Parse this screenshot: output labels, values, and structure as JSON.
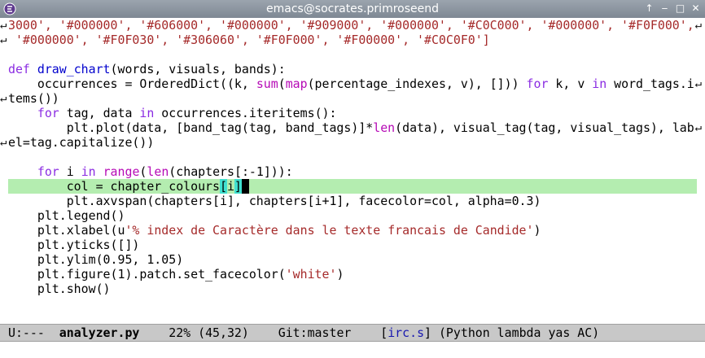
{
  "window": {
    "title": "emacs@socrates.primroseend",
    "colors": {
      "titlebar": "#8a939d",
      "highlight": "#b4edb0",
      "modeline": "#c8c8c8"
    }
  },
  "code": {
    "l0": "3000', '#000000', '#606000', '#000000', '#909000', '#000000', '#C0C000', '#000000', '#F0F000',",
    "l1": " '#000000', '#F0F030', '#306060', '#F0F000', '#F00000', '#C0C0F0']",
    "l3a": "def",
    "l3b": " ",
    "l3c": "draw_chart",
    "l3d": "(words, visuals, bands):",
    "l4a": "    occurrences = OrderedDict((k, ",
    "l4b": "sum",
    "l4c": "(",
    "l4d": "map",
    "l4e": "(percentage_indexes, v), [])) ",
    "l4f": "for",
    "l4g": " k, v ",
    "l4h": "in",
    "l4i": " word_tags.i",
    "l5": "tems())",
    "l6a": "    ",
    "l6b": "for",
    "l6c": " tag, data ",
    "l6d": "in",
    "l6e": " occurrences.iteritems():",
    "l7a": "        plt.plot(data, [band_tag(tag, band_tags)]*",
    "l7b": "len",
    "l7c": "(data), visual_tag(tag, visual_tags), lab",
    "l8": "el=tag.capitalize())",
    "l10a": "    ",
    "l10b": "for",
    "l10c": " i ",
    "l10d": "in",
    "l10e": " ",
    "l10f": "range",
    "l10g": "(",
    "l10h": "len",
    "l10i": "(chapters[:-1])):",
    "l11a": "        col = chapter_colours",
    "l11b": "[",
    "l11c": "i",
    "l11d": "]",
    "l11e": " ",
    "l12": "        plt.axvspan(chapters[i], chapters[i+1], facecolor=col, alpha=0.3)",
    "l13": "    plt.legend()",
    "l14a": "    plt.xlabel(u",
    "l14b": "'% index de Caractère dans le texte francais de Candide'",
    "l14c": ")",
    "l15": "    plt.yticks([])",
    "l16": "    plt.ylim(0.95, 1.05)",
    "l17a": "    plt.figure(1).patch.set_facecolor(",
    "l17b": "'white'",
    "l17c": ")",
    "l18": "    plt.show()"
  },
  "modeline": {
    "state": "U:---  ",
    "buffer": "analyzer.py",
    "position": "    22% (45,32)    Git:master    ",
    "project_open": "[",
    "project": "irc.s",
    "project_close": "]",
    "mode": " (Python lambda yas AC)"
  },
  "markers": {
    "wrap": "↵",
    "cont": "↵"
  }
}
